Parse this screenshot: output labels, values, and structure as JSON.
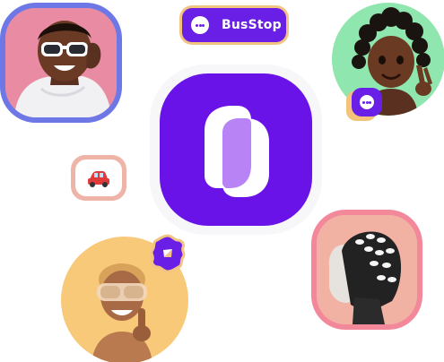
{
  "brand": {
    "name": "BusStop",
    "accent": "#6a1fe6",
    "accent_secondary": "#f3c47f"
  },
  "pill": {
    "label": "BusStop",
    "icon": "chat-bubble-icon"
  },
  "app_icon": {
    "icon": "busstop-logo-icon"
  },
  "chips": {
    "car": {
      "icon": "car-emoji-icon",
      "emoji": "🚗"
    }
  },
  "badges": {
    "chat": {
      "icon": "chat-bubble-icon"
    },
    "compass": {
      "icon": "compass-icon"
    }
  },
  "avatars": [
    {
      "kind": "photo",
      "description_icon": "avatar-man-sunglasses",
      "ring_color": "#6d78e6",
      "bg_color": "#e98ca3"
    },
    {
      "kind": "memoji",
      "description_icon": "avatar-girl-locs",
      "bg_color": "#8fe6ae"
    },
    {
      "kind": "memoji",
      "description_icon": "avatar-woman-goggles",
      "bg_color": "#f7c978"
    },
    {
      "kind": "photo",
      "description_icon": "avatar-profile-braids",
      "ring_color": "#f3889a",
      "bg_color": "#f2b2a3"
    }
  ]
}
